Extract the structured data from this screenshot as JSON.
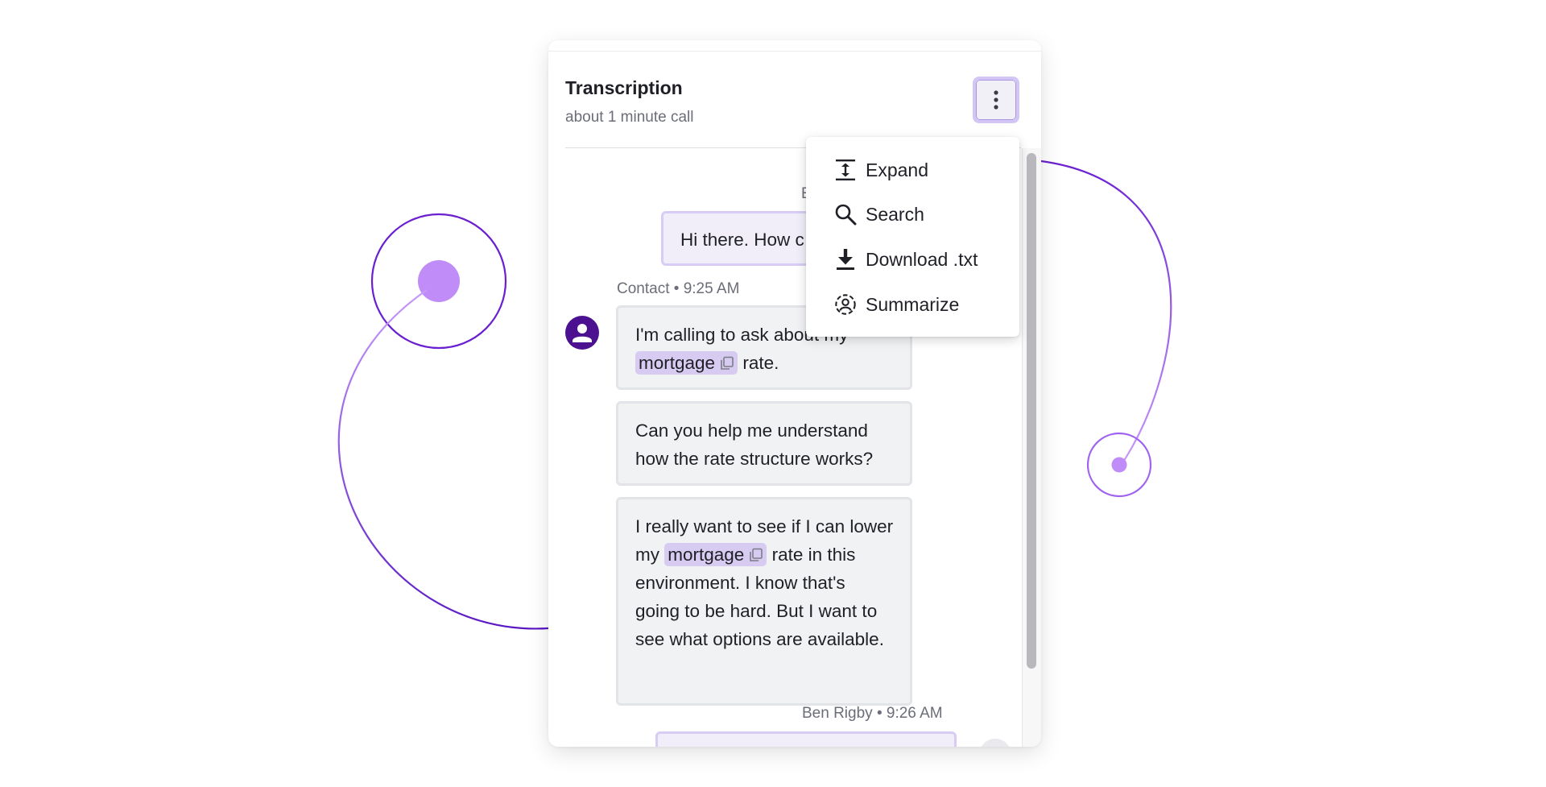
{
  "panel": {
    "title": "Transcription",
    "subtitle": "about 1 minute call",
    "more_button_icon": "more-vertical-icon"
  },
  "menu": {
    "items": [
      {
        "label": "Expand",
        "icon": "expand-vertical-icon"
      },
      {
        "label": "Search",
        "icon": "search-icon"
      },
      {
        "label": "Download .txt",
        "icon": "download-icon"
      },
      {
        "label": "Summarize",
        "icon": "summarize-icon"
      }
    ]
  },
  "messages": {
    "agent_first": {
      "meta_partial": "E",
      "text": "Hi there. How c"
    },
    "contact": {
      "meta": "Contact • 9:25 AM",
      "avatar_icon": "person-icon",
      "bubble1": {
        "text_before": "I'm calling to ask about my",
        "highlight": "mortgage",
        "text_after": "rate."
      },
      "bubble2": {
        "text": "Can you help me understand how the rate structure works?"
      },
      "bubble3": {
        "text_before": "I really want to see if I can lower my",
        "highlight": "mortgage",
        "text_after": "rate in this environment. I know that's going to be hard. But I want to see what options are available."
      }
    },
    "agent_second": {
      "meta": "Ben Rigby • 9:26 AM"
    }
  },
  "icons": {
    "copy": "copy-icon"
  },
  "colors": {
    "accent": "#7b2fd6",
    "accent_light": "#c08cf7",
    "avatar": "#4b1190",
    "highlight": "#d8cbf2",
    "button_focus": "#d3c6f4"
  }
}
